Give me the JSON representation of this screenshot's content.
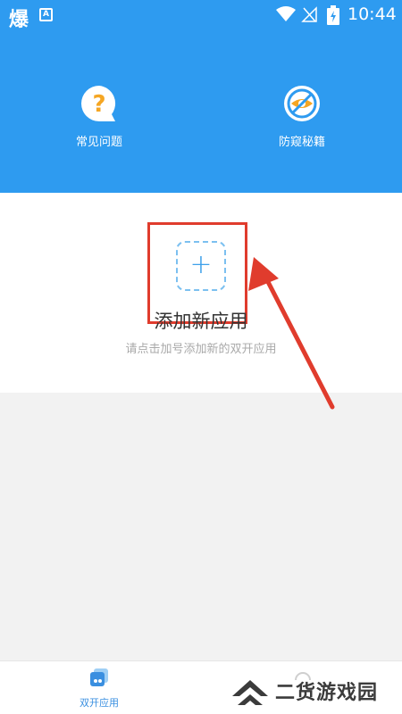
{
  "status_bar": {
    "app_glyph": "爆",
    "badge": "A",
    "time": "10:44"
  },
  "header": {
    "items": [
      {
        "label": "常见问题",
        "icon": "question-bubble-icon"
      },
      {
        "label": "防窥秘籍",
        "icon": "no-eye-icon"
      }
    ]
  },
  "main": {
    "add_title": "添加新应用",
    "add_hint": "请点击加号添加新的双开应用",
    "plus_symbol": "+"
  },
  "bottom_nav": {
    "items": [
      {
        "label": "双开应用",
        "icon": "dual-app-icon"
      }
    ]
  },
  "watermark": {
    "text": "二货游戏园"
  },
  "colors": {
    "primary": "#2e9bf0",
    "highlight": "#e03c2d",
    "faq_icon": "#f5a623"
  }
}
